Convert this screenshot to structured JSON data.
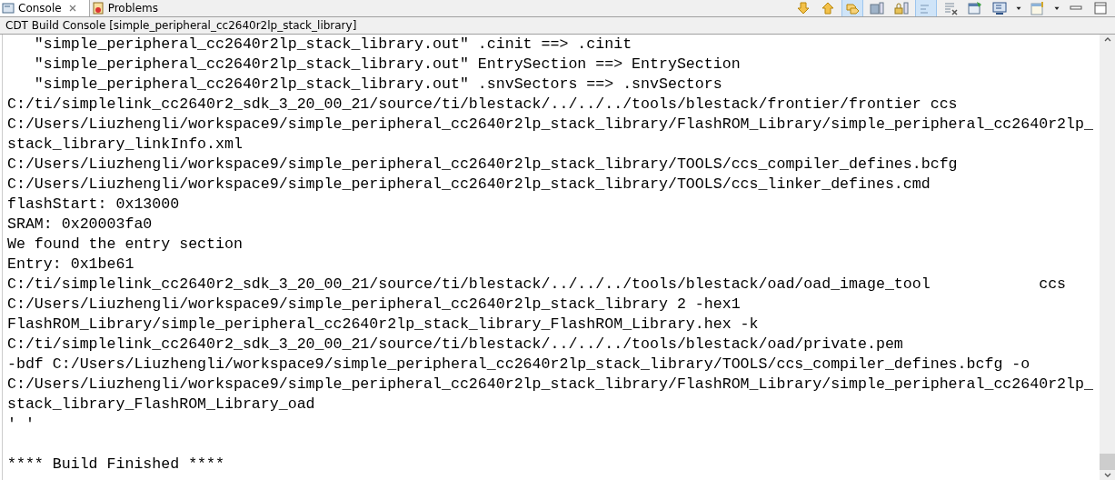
{
  "tabs": [
    {
      "label": "Console",
      "selected": true,
      "closable": true
    },
    {
      "label": "Problems",
      "selected": false,
      "closable": false
    }
  ],
  "toolbar": [
    {
      "kind": "down",
      "pressed": false
    },
    {
      "kind": "up",
      "pressed": false
    },
    {
      "kind": "pin",
      "pressed": true
    },
    {
      "kind": "save",
      "pressed": false
    },
    {
      "kind": "lock",
      "pressed": false
    },
    {
      "kind": "wrap",
      "pressed": true
    },
    {
      "kind": "clear",
      "pressed": false
    },
    {
      "kind": "newconsole",
      "pressed": false
    },
    {
      "kind": "display",
      "pressed": false
    },
    {
      "kind": "dropdown",
      "pressed": false
    },
    {
      "kind": "open",
      "pressed": false
    },
    {
      "kind": "dropdown",
      "pressed": false
    },
    {
      "kind": "minimize",
      "pressed": false
    },
    {
      "kind": "maximize",
      "pressed": false
    }
  ],
  "console": {
    "title": "CDT Build Console [simple_peripheral_cc2640r2lp_stack_library]",
    "lines": [
      "   \"simple_peripheral_cc2640r2lp_stack_library.out\" .cinit ==> .cinit",
      "   \"simple_peripheral_cc2640r2lp_stack_library.out\" EntrySection ==> EntrySection",
      "   \"simple_peripheral_cc2640r2lp_stack_library.out\" .snvSectors ==> .snvSectors",
      "C:/ti/simplelink_cc2640r2_sdk_3_20_00_21/source/ti/blestack/../../../tools/blestack/frontier/frontier ccs",
      "C:/Users/Liuzhengli/workspace9/simple_peripheral_cc2640r2lp_stack_library/FlashROM_Library/simple_peripheral_cc2640r2lp_",
      "stack_library_linkInfo.xml",
      "C:/Users/Liuzhengli/workspace9/simple_peripheral_cc2640r2lp_stack_library/TOOLS/ccs_compiler_defines.bcfg",
      "C:/Users/Liuzhengli/workspace9/simple_peripheral_cc2640r2lp_stack_library/TOOLS/ccs_linker_defines.cmd",
      "flashStart: 0x13000",
      "SRAM: 0x20003fa0",
      "We found the entry section",
      "Entry: 0x1be61",
      "C:/ti/simplelink_cc2640r2_sdk_3_20_00_21/source/ti/blestack/../../../tools/blestack/oad/oad_image_tool            ccs",
      "C:/Users/Liuzhengli/workspace9/simple_peripheral_cc2640r2lp_stack_library 2 -hex1",
      "FlashROM_Library/simple_peripheral_cc2640r2lp_stack_library_FlashROM_Library.hex -k",
      "C:/ti/simplelink_cc2640r2_sdk_3_20_00_21/source/ti/blestack/../../../tools/blestack/oad/private.pem",
      "-bdf C:/Users/Liuzhengli/workspace9/simple_peripheral_cc2640r2lp_stack_library/TOOLS/ccs_compiler_defines.bcfg -o",
      "C:/Users/Liuzhengli/workspace9/simple_peripheral_cc2640r2lp_stack_library/FlashROM_Library/simple_peripheral_cc2640r2lp_",
      "stack_library_FlashROM_Library_oad",
      "' '"
    ],
    "footer": "**** Build Finished ****"
  }
}
